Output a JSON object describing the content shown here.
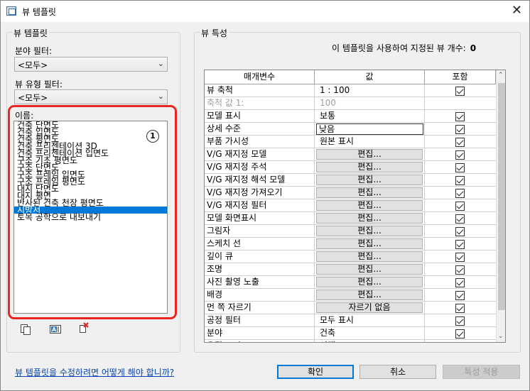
{
  "window": {
    "title": "뷰 템플릿",
    "close_label": "✕"
  },
  "left": {
    "group_label": "뷰 템플릿",
    "discipline_filter_label": "분야 필터:",
    "discipline_filter_value": "<모두>",
    "viewtype_filter_label": "뷰 유형 필터:",
    "viewtype_filter_value": "<모두>",
    "names_label": "이름:",
    "badge": "1",
    "items": [
      "건축 단면도",
      "건축 입면도",
      "건축 평면도",
      "건축 프리젠테이션 3D",
      "건축 프리젠테이션 입면도",
      "구조 기초 평면도",
      "구조 단면도",
      "구조 프레임 입면도",
      "구조 프레임 평면도",
      "대지 단면도",
      "대지 평면",
      "반사된 건축 천장 평면도",
      "시방서",
      "토목 공학으로 내보내기"
    ],
    "selected_index": 12,
    "tool_icons": [
      "duplicate-icon",
      "rename-icon",
      "delete-icon"
    ]
  },
  "right": {
    "group_label": "뷰 특성",
    "count_label": "이 템플릿을 사용하여 지정된 뷰 개수:",
    "count_value": "0",
    "columns": [
      "매개변수",
      "값",
      "포함"
    ],
    "rows": [
      {
        "param": "뷰 축척",
        "value": "1 : 100",
        "kind": "text",
        "include": true
      },
      {
        "param": "축척 값   1:",
        "value": "100",
        "kind": "text",
        "include": null,
        "dim": true
      },
      {
        "param": "모델 표시",
        "value": "보통",
        "kind": "text",
        "include": true
      },
      {
        "param": "상세 수준",
        "value": "낮음",
        "kind": "edit",
        "include": true
      },
      {
        "param": "부품 가시성",
        "value": "원본 표시",
        "kind": "text",
        "include": true
      },
      {
        "param": "V/G 재지정 모델",
        "value": "편집...",
        "kind": "button",
        "include": true
      },
      {
        "param": "V/G 재지정 주석",
        "value": "편집...",
        "kind": "button",
        "include": true
      },
      {
        "param": "V/G 재지정 해석 모델",
        "value": "편집...",
        "kind": "button",
        "include": true
      },
      {
        "param": "V/G 재지정 가져오기",
        "value": "편집...",
        "kind": "button",
        "include": true
      },
      {
        "param": "V/G 재지정 필터",
        "value": "편집...",
        "kind": "button",
        "include": true
      },
      {
        "param": "모델 화면표시",
        "value": "편집...",
        "kind": "button",
        "include": true
      },
      {
        "param": "그림자",
        "value": "편집...",
        "kind": "button",
        "include": true
      },
      {
        "param": "스케치 선",
        "value": "편집...",
        "kind": "button",
        "include": true
      },
      {
        "param": "깊이 큐",
        "value": "편집...",
        "kind": "button",
        "include": true
      },
      {
        "param": "조명",
        "value": "편집...",
        "kind": "button",
        "include": true
      },
      {
        "param": "사진 촬영 노출",
        "value": "편집...",
        "kind": "button",
        "include": true
      },
      {
        "param": "배경",
        "value": "편집...",
        "kind": "button",
        "include": true
      },
      {
        "param": "먼 쪽 자르기",
        "value": "자르기 없음",
        "kind": "button",
        "include": true
      },
      {
        "param": "공정 필터",
        "value": "모두 표시",
        "kind": "text",
        "include": true
      },
      {
        "param": "분야",
        "value": "건축",
        "kind": "text",
        "include": true
      },
      {
        "param": "유틸 표시",
        "value": "선택",
        "kind": "text",
        "include": true
      }
    ]
  },
  "footer": {
    "help_link": "뷰 템플릿을 수정하려면 어떻게 해야 합니까?",
    "ok_label": "확인",
    "cancel_label": "취소",
    "apply_label": "특성 적용"
  }
}
